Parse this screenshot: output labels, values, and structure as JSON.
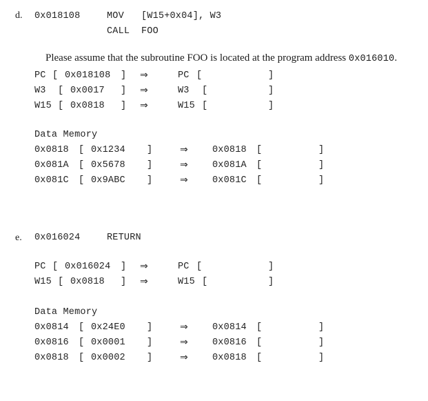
{
  "page": {
    "background": "#ffffff",
    "text_color": "#1a1a1a"
  },
  "symbols": {
    "arrow": "⇒",
    "bracket_open": "[",
    "bracket_close": "]"
  },
  "sections": [
    {
      "id": "d",
      "marker": "d.",
      "instructions": [
        {
          "address": "0x018108",
          "mnemonic": "MOV",
          "operands": "[W15+0x04], W3"
        },
        {
          "address": "",
          "mnemonic": "CALL",
          "operands": "FOO"
        }
      ],
      "note": {
        "before": "Please assume that the subroutine FOO is located at the program address ",
        "code": "0x016010",
        "after": "."
      },
      "registers": [
        {
          "name": "PC",
          "before_value": "0x018108",
          "after_value": ""
        },
        {
          "name": "W3",
          "before_value": "0x0017",
          "after_value": ""
        },
        {
          "name": "W15",
          "before_value": "0x0818",
          "after_value": ""
        }
      ],
      "memory": {
        "heading": "Data Memory",
        "rows": [
          {
            "address": "0x0818",
            "before_value": "0x1234",
            "after_address": "0x0818",
            "after_value": ""
          },
          {
            "address": "0x081A",
            "before_value": "0x5678",
            "after_address": "0x081A",
            "after_value": ""
          },
          {
            "address": "0x081C",
            "before_value": "0x9ABC",
            "after_address": "0x081C",
            "after_value": ""
          }
        ]
      }
    },
    {
      "id": "e",
      "marker": "e.",
      "instructions": [
        {
          "address": "0x016024",
          "mnemonic": "RETURN",
          "operands": ""
        }
      ],
      "note": null,
      "registers": [
        {
          "name": "PC",
          "before_value": "0x016024",
          "after_value": ""
        },
        {
          "name": "W15",
          "before_value": "0x0818",
          "after_value": ""
        }
      ],
      "memory": {
        "heading": "Data Memory",
        "rows": [
          {
            "address": "0x0814",
            "before_value": "0x24E0",
            "after_address": "0x0814",
            "after_value": ""
          },
          {
            "address": "0x0816",
            "before_value": "0x0001",
            "after_address": "0x0816",
            "after_value": ""
          },
          {
            "address": "0x0818",
            "before_value": "0x0002",
            "after_address": "0x0818",
            "after_value": ""
          }
        ]
      }
    }
  ]
}
